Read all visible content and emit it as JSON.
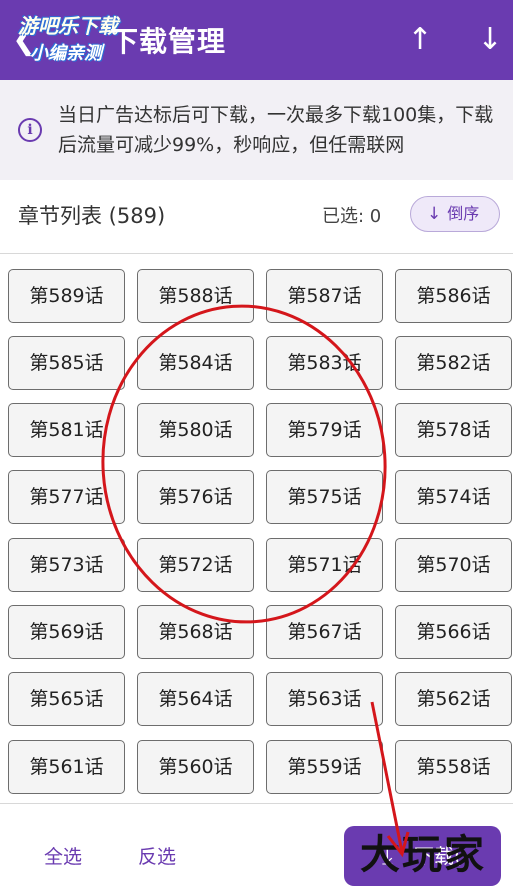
{
  "header": {
    "title": "下载管理",
    "back_icon": "chevron-left-icon",
    "up_icon": "arrow-up-icon",
    "down_icon": "arrow-down-icon",
    "watermark_line1": "游吧乐下载",
    "watermark_line2": "小编亲测",
    "bg_color": "#6a3bb0"
  },
  "notice": {
    "icon": "info-icon",
    "text": "当日广告达标后可下载，一次最多下载100集，下载后流量可减少99%，秒响应，但任需联网"
  },
  "chapters": {
    "title": "章节列表 (589)",
    "selected_label": "已选: 0",
    "sort_label": "倒序",
    "items": [
      "第589话",
      "第588话",
      "第587话",
      "第586话",
      "第585话",
      "第584话",
      "第583话",
      "第582话",
      "第581话",
      "第580话",
      "第579话",
      "第578话",
      "第577话",
      "第576话",
      "第575话",
      "第574话",
      "第573话",
      "第572话",
      "第571话",
      "第570话",
      "第569话",
      "第568话",
      "第567话",
      "第566话",
      "第565话",
      "第564话",
      "第563话",
      "第562话",
      "第561话",
      "第560话",
      "第559话",
      "第558话"
    ]
  },
  "bottom": {
    "select_all": "全选",
    "invert": "反选",
    "download_label": "下载(",
    "brand_watermark": "大玩家"
  },
  "annotation": {
    "color": "#d4161b"
  }
}
